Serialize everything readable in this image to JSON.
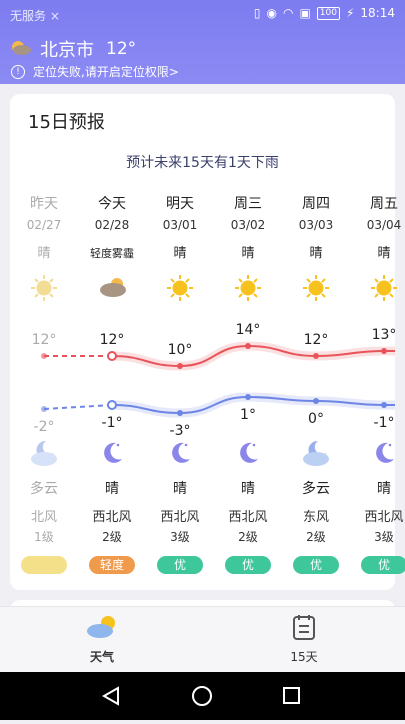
{
  "status": {
    "left": "无服务 ×",
    "time": "18:14",
    "battery": "100"
  },
  "header": {
    "city": "北京市",
    "temp": "12°",
    "warning": "定位失败,请开启定位权限>"
  },
  "card": {
    "title": "15日预报",
    "summary": "预计未来15天有1天下雨"
  },
  "days": [
    {
      "day": "昨天",
      "date": "02/27",
      "day_desc": "晴",
      "hi": "12°",
      "lo": "-2°",
      "night_desc": "多云",
      "wind_dir": "北风",
      "wind_lv": "1级",
      "aqi": "",
      "aqi_color": "#f5e08a",
      "past": true
    },
    {
      "day": "今天",
      "date": "02/28",
      "day_desc": "轻度雾霾",
      "hi": "12°",
      "lo": "-1°",
      "night_desc": "晴",
      "wind_dir": "西北风",
      "wind_lv": "2级",
      "aqi": "轻度",
      "aqi_color": "#f09a4c",
      "past": false
    },
    {
      "day": "明天",
      "date": "03/01",
      "day_desc": "晴",
      "hi": "10°",
      "lo": "-3°",
      "night_desc": "晴",
      "wind_dir": "西北风",
      "wind_lv": "3级",
      "aqi": "优",
      "aqi_color": "#3ec79a",
      "past": false
    },
    {
      "day": "周三",
      "date": "03/02",
      "day_desc": "晴",
      "hi": "14°",
      "lo": "1°",
      "night_desc": "晴",
      "wind_dir": "西北风",
      "wind_lv": "2级",
      "aqi": "优",
      "aqi_color": "#3ec79a",
      "past": false
    },
    {
      "day": "周四",
      "date": "03/03",
      "day_desc": "晴",
      "hi": "12°",
      "lo": "0°",
      "night_desc": "多云",
      "wind_dir": "东风",
      "wind_lv": "2级",
      "aqi": "优",
      "aqi_color": "#3ec79a",
      "past": false
    },
    {
      "day": "周五",
      "date": "03/04",
      "day_desc": "晴",
      "hi": "13°",
      "lo": "-1°",
      "night_desc": "晴",
      "wind_dir": "西北风",
      "wind_lv": "3级",
      "aqi": "优",
      "aqi_color": "#3ec79a",
      "past": false
    }
  ],
  "nav": {
    "weather_label": "天气",
    "forecast_label": "15天"
  },
  "colors": {
    "header": "#8584f2",
    "high_line": "#e9545a",
    "low_line": "#6d86e6",
    "moon": "#8a86ea"
  }
}
